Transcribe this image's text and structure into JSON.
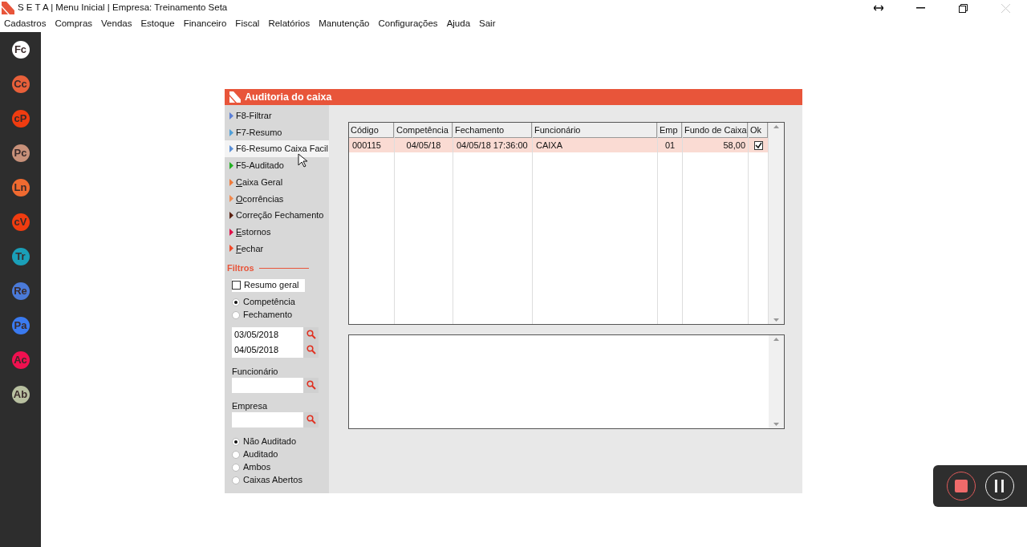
{
  "window": {
    "title": "S E T A | Menu Inicial | Empresa: Treinamento Seta"
  },
  "menu": [
    "Cadastros",
    "Compras",
    "Vendas",
    "Estoque",
    "Financeiro",
    "Fiscal",
    "Relatórios",
    "Manutenção",
    "Configurações",
    "Ajuda",
    "Sair"
  ],
  "sidebar": {
    "items": [
      {
        "label": "Fc",
        "color": "#ffffff"
      },
      {
        "label": "Cc",
        "color": "#e8603a"
      },
      {
        "label": "cP",
        "color": "#f03c10"
      },
      {
        "label": "Pc",
        "color": "#c8917a"
      },
      {
        "label": "Ln",
        "color": "#f06a30"
      },
      {
        "label": "cV",
        "color": "#f03c10"
      },
      {
        "label": "Tr",
        "color": "#1a9fb8"
      },
      {
        "label": "Re",
        "color": "#4a7ad8"
      },
      {
        "label": "Pa",
        "color": "#3a7af0"
      },
      {
        "label": "Ac",
        "color": "#f01050"
      },
      {
        "label": "Ab",
        "color": "#b8c0a0"
      }
    ]
  },
  "dialog": {
    "title": "Auditoria do caixa",
    "actions": [
      {
        "label": "F8-Filtrar",
        "color": "#5b7fd6",
        "underline_first": false,
        "hovered": false
      },
      {
        "label": "F7-Resumo",
        "color": "#4f9fd8",
        "underline_first": false,
        "hovered": false
      },
      {
        "label": "F6-Resumo Caixa Facil",
        "color": "#5b8fd6",
        "underline_first": false,
        "hovered": true
      },
      {
        "label": "F5-Auditado",
        "color": "#22b022",
        "underline_first": false,
        "hovered": false
      },
      {
        "label": "Caixa Geral",
        "color": "#f07a3a",
        "underline_first": true,
        "hovered": false
      },
      {
        "label": "Ocorrências",
        "color": "#f08a50",
        "underline_first": true,
        "hovered": false
      },
      {
        "label": "Correção Fechamento",
        "color": "#5a2010",
        "underline_first": false,
        "hovered": false
      },
      {
        "label": "Estornos",
        "color": "#e0104a",
        "underline_first": true,
        "hovered": false
      },
      {
        "label": "Fechar",
        "color": "#f04a2a",
        "underline_first": true,
        "hovered": false
      }
    ],
    "filters": {
      "heading": "Filtros",
      "summary": {
        "label": "Resumo geral",
        "checked": false
      },
      "date_type": [
        {
          "label": "Competência",
          "selected": true
        },
        {
          "label": "Fechamento",
          "selected": false
        }
      ],
      "dates": [
        {
          "value": "03/05/2018"
        },
        {
          "value": "04/05/2018"
        }
      ],
      "fields": [
        {
          "label": "Funcionário"
        },
        {
          "label": "Empresa"
        }
      ],
      "audit_state": [
        {
          "label": "Não Auditado",
          "selected": true
        },
        {
          "label": "Auditado",
          "selected": false
        },
        {
          "label": "Ambos",
          "selected": false
        },
        {
          "label": "Caixas Abertos",
          "selected": false
        }
      ]
    },
    "table": {
      "columns": [
        "Código",
        "Competência",
        "Fechamento",
        "Funcionário",
        "Emp",
        "Fundo de Caixa",
        "Ok"
      ],
      "rows": [
        {
          "cells": [
            "000115",
            "04/05/18",
            "04/05/18 17:36:00",
            "CAIXA",
            "01",
            "58,00"
          ],
          "ok": true,
          "selected": true
        }
      ]
    }
  }
}
